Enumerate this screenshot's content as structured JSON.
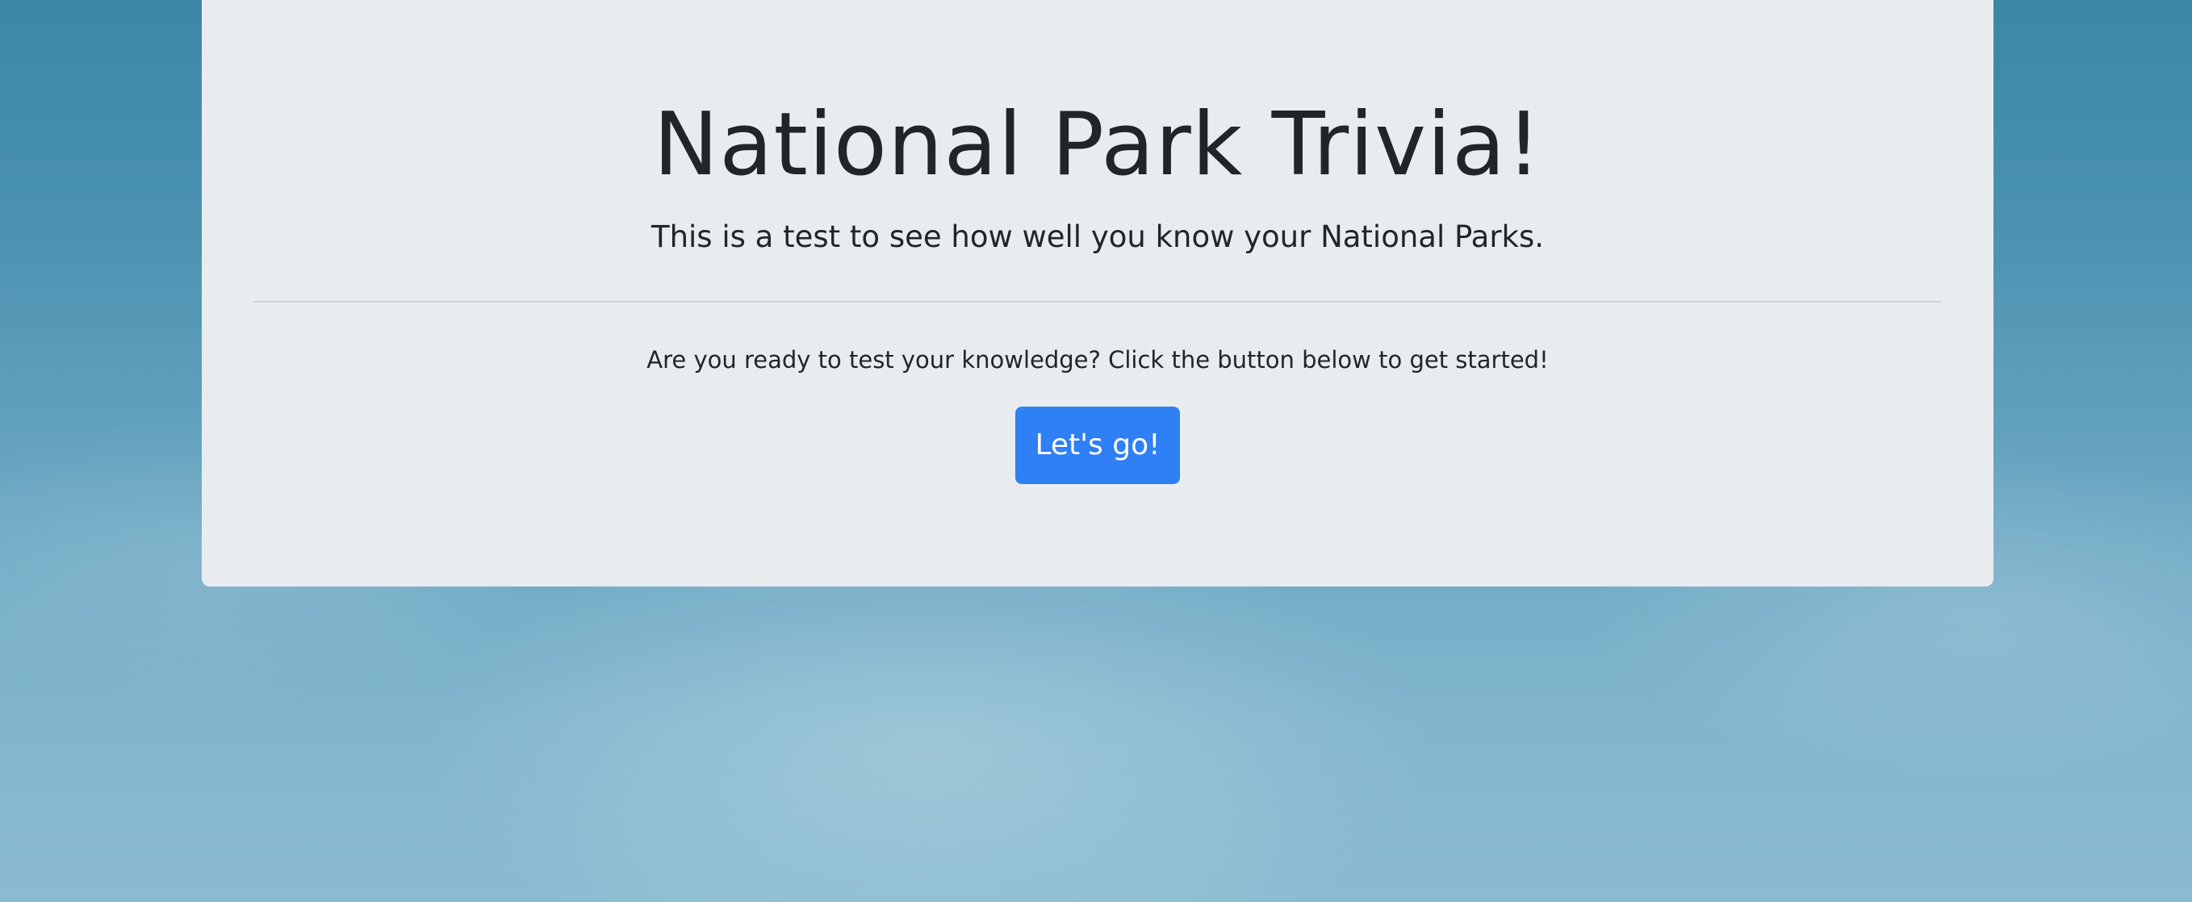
{
  "hero": {
    "title": "National Park Trivia!",
    "subtitle": "This is a test to see how well you know your National Parks.",
    "prompt": "Are you ready to test your knowledge? Click the button below to get started!",
    "start_button_label": "Let's go!"
  },
  "colors": {
    "panel_background": "#e9ecef",
    "button_background": "#2f7ff5",
    "text": "#212529",
    "sky_top": "#3d86a6",
    "sky_bottom": "#8bbbd1"
  }
}
